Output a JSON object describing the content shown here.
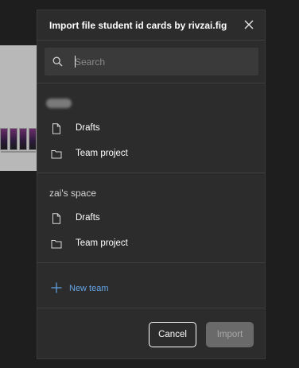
{
  "dialog": {
    "title": "Import file student id cards by rivzai.fig",
    "search_placeholder": "Search",
    "sections": [
      {
        "owner_label": "",
        "items": [
          {
            "label": "Drafts",
            "icon": "file-icon"
          },
          {
            "label": "Team project",
            "icon": "folder-icon"
          }
        ]
      },
      {
        "owner_label": "zai's space",
        "items": [
          {
            "label": "Drafts",
            "icon": "file-icon"
          },
          {
            "label": "Team project",
            "icon": "folder-icon"
          }
        ]
      }
    ],
    "new_team_label": "New team",
    "cancel_label": "Cancel",
    "import_label": "Import"
  },
  "colors": {
    "modal_bg": "#2c2c2c",
    "search_bg": "#3a3a3a",
    "accent_link": "#63a4e6",
    "disabled_button": "#6a6a6a"
  }
}
